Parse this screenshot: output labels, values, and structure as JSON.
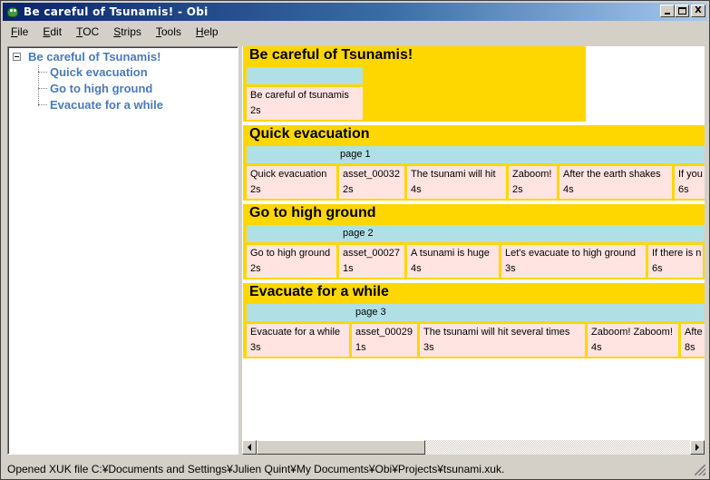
{
  "window": {
    "title": "Be careful of Tsunamis! - Obi",
    "min_symbol": "_",
    "close_symbol": "X"
  },
  "menu": [
    "File",
    "Edit",
    "TOC",
    "Strips",
    "Tools",
    "Help"
  ],
  "menu_accel": [
    "F",
    "E",
    "T",
    "S",
    "T",
    "H"
  ],
  "tree": {
    "root": "Be careful of Tsunamis!",
    "children": [
      "Quick evacuation",
      "Go to high ground",
      "Evacuate for a while"
    ]
  },
  "strips": [
    {
      "title": "Be careful of Tsunamis!",
      "page": "",
      "blocks": [
        {
          "label": "Be careful of tsunamis",
          "duration": "2s"
        }
      ]
    },
    {
      "title": "Quick evacuation",
      "page": "page 1",
      "blocks": [
        {
          "label": "Quick evacuation",
          "duration": "2s"
        },
        {
          "label": "asset_00032",
          "duration": "2s"
        },
        {
          "label": "The tsunami will hit",
          "duration": "4s"
        },
        {
          "label": "Zaboom!",
          "duration": "2s"
        },
        {
          "label": "After the earth shakes",
          "duration": "4s"
        },
        {
          "label": "If you",
          "duration": "6s"
        }
      ]
    },
    {
      "title": "Go to high ground",
      "page": "page 2",
      "blocks": [
        {
          "label": "Go to high ground",
          "duration": "2s"
        },
        {
          "label": "asset_00027",
          "duration": "1s"
        },
        {
          "label": "A tsunami is huge",
          "duration": "4s"
        },
        {
          "label": "Let's evacuate to high ground",
          "duration": "3s"
        },
        {
          "label": "If there is n",
          "duration": "6s"
        }
      ]
    },
    {
      "title": "Evacuate for a while",
      "page": "page 3",
      "blocks": [
        {
          "label": "Evacuate for a while",
          "duration": "3s"
        },
        {
          "label": "asset_00029",
          "duration": "1s"
        },
        {
          "label": "The tsunami will hit several times",
          "duration": "3s"
        },
        {
          "label": "Zaboom! Zaboom!",
          "duration": "4s"
        },
        {
          "label": "Afte",
          "duration": "8s"
        }
      ]
    }
  ],
  "status": "Opened XUK file C:¥Documents and Settings¥Julien Quint¥My Documents¥Obi¥Projects¥tsunami.xuk.",
  "colors": {
    "strip_bg": "#ffd700",
    "page_bg": "#b0e0e6",
    "block_bg": "#ffe4e1",
    "tree_text": "#4a7ab8"
  }
}
